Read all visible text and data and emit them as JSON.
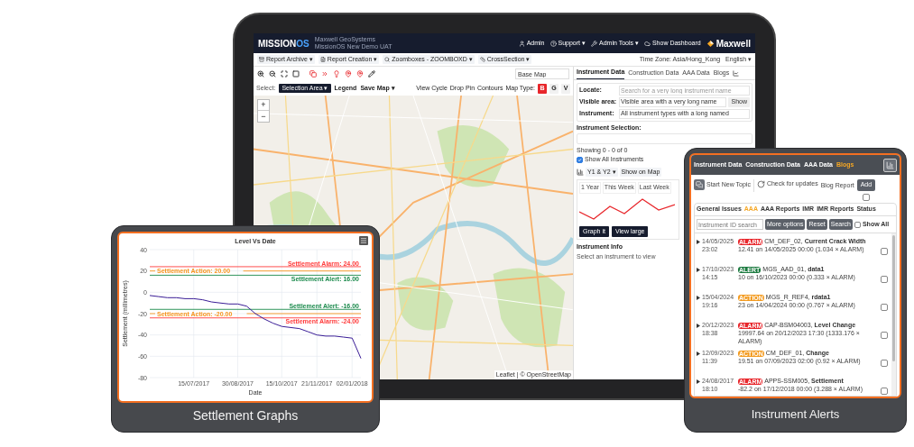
{
  "navbar": {
    "logo_main": "MISSION",
    "logo_accent": "OS",
    "company": "Maxwell GeoSystems",
    "project": "MissionOS New Demo UAT",
    "links": [
      "Admin",
      "Support ▾",
      "Admin Tools ▾",
      "Show Dashboard"
    ],
    "brand": "Maxwell"
  },
  "menu_bar": {
    "menus": [
      "Report Archive ▾",
      "Report Creation ▾",
      "Zoomboxes - ZOOMBOXD ▾",
      "CrossSection ▾"
    ],
    "timezone": "Time Zone: Asia/Hong_Kong",
    "language": "English ▾"
  },
  "map_toolbar": {
    "base_map": "Base Map"
  },
  "select_row": {
    "label": "Select:",
    "selection_button": "Selection Area ▾",
    "legend": "Legend",
    "save_map": "Save Map ▾",
    "links": [
      "View Cycle",
      "Drop Pin",
      "Contours"
    ],
    "map_type_label": "Map Type:",
    "map_types": [
      {
        "label": "B",
        "selected": true
      },
      {
        "label": "G",
        "selected": false
      },
      {
        "label": "V",
        "selected": false
      }
    ]
  },
  "map": {
    "zoom_in": "+",
    "zoom_out": "−",
    "attribution": "Leaflet | © OpenStreetMap"
  },
  "side_panel": {
    "tabs": [
      {
        "label": "Instrument Data",
        "selected": true
      },
      {
        "label": "Construction Data",
        "selected": false
      },
      {
        "label": "AAA Data",
        "selected": false
      },
      {
        "label": "Blogs",
        "selected": false
      }
    ],
    "locate_label": "Locate:",
    "locate_placeholder": "Search for a very long instrument name",
    "visible_label": "Visible area:",
    "visible_value": "Visible area with a very long name",
    "show_button": "Show",
    "instrument_label": "Instrument:",
    "instrument_value": "All instrument types with a long named",
    "selection_label": "Instrument Selection:",
    "showing": "Showing 0 - 0 of 0",
    "show_all": {
      "label": "Show All Instruments",
      "checked": true
    },
    "axis_select": "Y1 & Y2 ▾",
    "show_on_map": "Show on Map",
    "ranges": [
      "1 Year",
      "This Week",
      "Last Week"
    ],
    "buttons": [
      "Graph it",
      "View large"
    ],
    "info_title": "Instrument Info",
    "info_text": "Select an instrument to view"
  },
  "graph_card": {
    "caption": "Settlement Graphs",
    "chart_data": {
      "type": "line",
      "title": "Level Vs Date",
      "xlabel": "Date",
      "ylabel": "Settlement (millimetres)",
      "categories": [
        null,
        null,
        null,
        null,
        null,
        "15/07/2017",
        null,
        null,
        null,
        null,
        "30/08/2017",
        null,
        null,
        null,
        null,
        "15/10/2017",
        null,
        null,
        null,
        "21/11/2017",
        null,
        null,
        null,
        "02/01/2018",
        null
      ],
      "ylim": [
        -80,
        40
      ],
      "yticks": [
        40,
        20,
        0,
        -20,
        -40,
        -60,
        -80
      ],
      "series": [
        {
          "color": "#3a1d96",
          "values": [
            -3,
            -4,
            -5,
            -5,
            -6,
            -6,
            -7,
            -9,
            -10,
            -11,
            -11,
            -13,
            -20,
            -25,
            -29,
            -32,
            -33,
            -34,
            -37,
            -40,
            -41,
            -41,
            -42,
            -43,
            -62
          ]
        }
      ],
      "grid": true,
      "ref_lines": [
        {
          "axis": "y",
          "value": 24,
          "label": "Settlement Alarm: 24.00",
          "color": "#ff3b3b"
        },
        {
          "axis": "y",
          "value": 20,
          "label": "Settlement Action: 20.00",
          "color": "#f7941d"
        },
        {
          "axis": "y",
          "value": 16,
          "label": "Settlement Alert: 16.00",
          "color": "#1b8a4c"
        },
        {
          "axis": "y",
          "value": -16,
          "label": "Settlement Alert: -16.00",
          "color": "#1b8a4c"
        },
        {
          "axis": "y",
          "value": -20,
          "label": "Settlement Action: -20.00",
          "color": "#f7941d"
        },
        {
          "axis": "y",
          "value": -24,
          "label": "Settlement Alarm: -24.00",
          "color": "#ff3b3b"
        }
      ]
    }
  },
  "alerts_card": {
    "caption": "Instrument Alerts",
    "tabs": [
      {
        "label": "Instrument Data",
        "selected": false
      },
      {
        "label": "Construction Data",
        "selected": false
      },
      {
        "label": "AAA Data",
        "selected": false
      },
      {
        "label": "Blogs",
        "selected": true
      }
    ],
    "start_topic": "Start New Topic",
    "check_updates": "Check for updates",
    "blog_report": "Blog Report",
    "add_button": "Add",
    "add_checked": false,
    "subtabs": [
      {
        "label": "General Issues",
        "selected": false
      },
      {
        "label": "AAA",
        "selected": true
      },
      {
        "label": "AAA Reports",
        "selected": false
      },
      {
        "label": "IMR",
        "selected": false
      },
      {
        "label": "IMR Reports",
        "selected": false
      },
      {
        "label": "Status",
        "selected": false
      }
    ],
    "search_placeholder": "Instrument ID search",
    "buttons": [
      "More options",
      "Reset",
      "Search"
    ],
    "show_all": {
      "label": "Show All",
      "checked": false
    },
    "alerts": [
      {
        "date": "14/05/2025 23:02",
        "kind": "alarm",
        "badge": "ALARM",
        "title": "CM_DEF_02, **Current Crack Width**",
        "detail": "12.41 on 14/05/2025 00:00 (1.034 × ALARM)",
        "checked": false
      },
      {
        "date": "17/10/2023 14:15",
        "kind": "alert",
        "badge": "ALERT",
        "title": "MGS_AAD_01, **data1**",
        "detail": "10 on 16/10/2023 00:00 (0.333 × ALARM)",
        "checked": false
      },
      {
        "date": "15/04/2024 19:16",
        "kind": "action",
        "badge": "ACTION",
        "title": "MGS_R_REF4, **rdata1**",
        "detail": "23 on 14/04/2024 00:00 (0.767 × ALARM)",
        "checked": false
      },
      {
        "date": "20/12/2023 18:38",
        "kind": "alarm",
        "badge": "ALARM",
        "title": "CAP-BSM04003, **Level Change**",
        "detail": "19997.64 on 20/12/2023 17:30 (1333.176 × ALARM)",
        "checked": false
      },
      {
        "date": "12/09/2023 11:39",
        "kind": "action",
        "badge": "ACTION",
        "title": "CM_DEF_01, **Change**",
        "detail": "19.51 on 07/09/2023 02:00 (0.92 × ALARM)",
        "checked": false
      },
      {
        "date": "24/08/2017 18:10",
        "kind": "alarm",
        "badge": "ALARM",
        "title": "APPS-SSM005, **Settlement**",
        "detail": "-82.2 on 17/12/2018 00:00 (3.288 × ALARM)",
        "checked": false
      }
    ]
  }
}
